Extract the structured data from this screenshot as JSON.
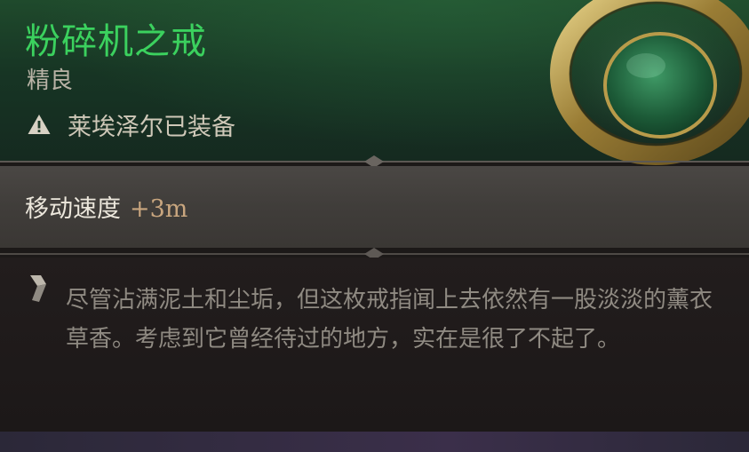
{
  "item": {
    "name": "粉碎机之戒",
    "rarity": "精良",
    "equipped_by": "莱埃泽尔已装备"
  },
  "stats": [
    {
      "label": "移动速度",
      "value": "+3m"
    }
  ],
  "lore": "尽管沾满泥土和尘垢，但这枚戒指闻上去依然有一股淡淡的薰衣草香。考虑到它曾经待过的地方，实在是很了不起了。",
  "colors": {
    "rarity_accent": "#3bd15e",
    "stat_value": "#c9a67f",
    "header_green": "#1f4a2c"
  },
  "icons": {
    "equipped": "warning-triangle-icon",
    "lore": "quote-icon",
    "item": "jade-ring-icon"
  }
}
